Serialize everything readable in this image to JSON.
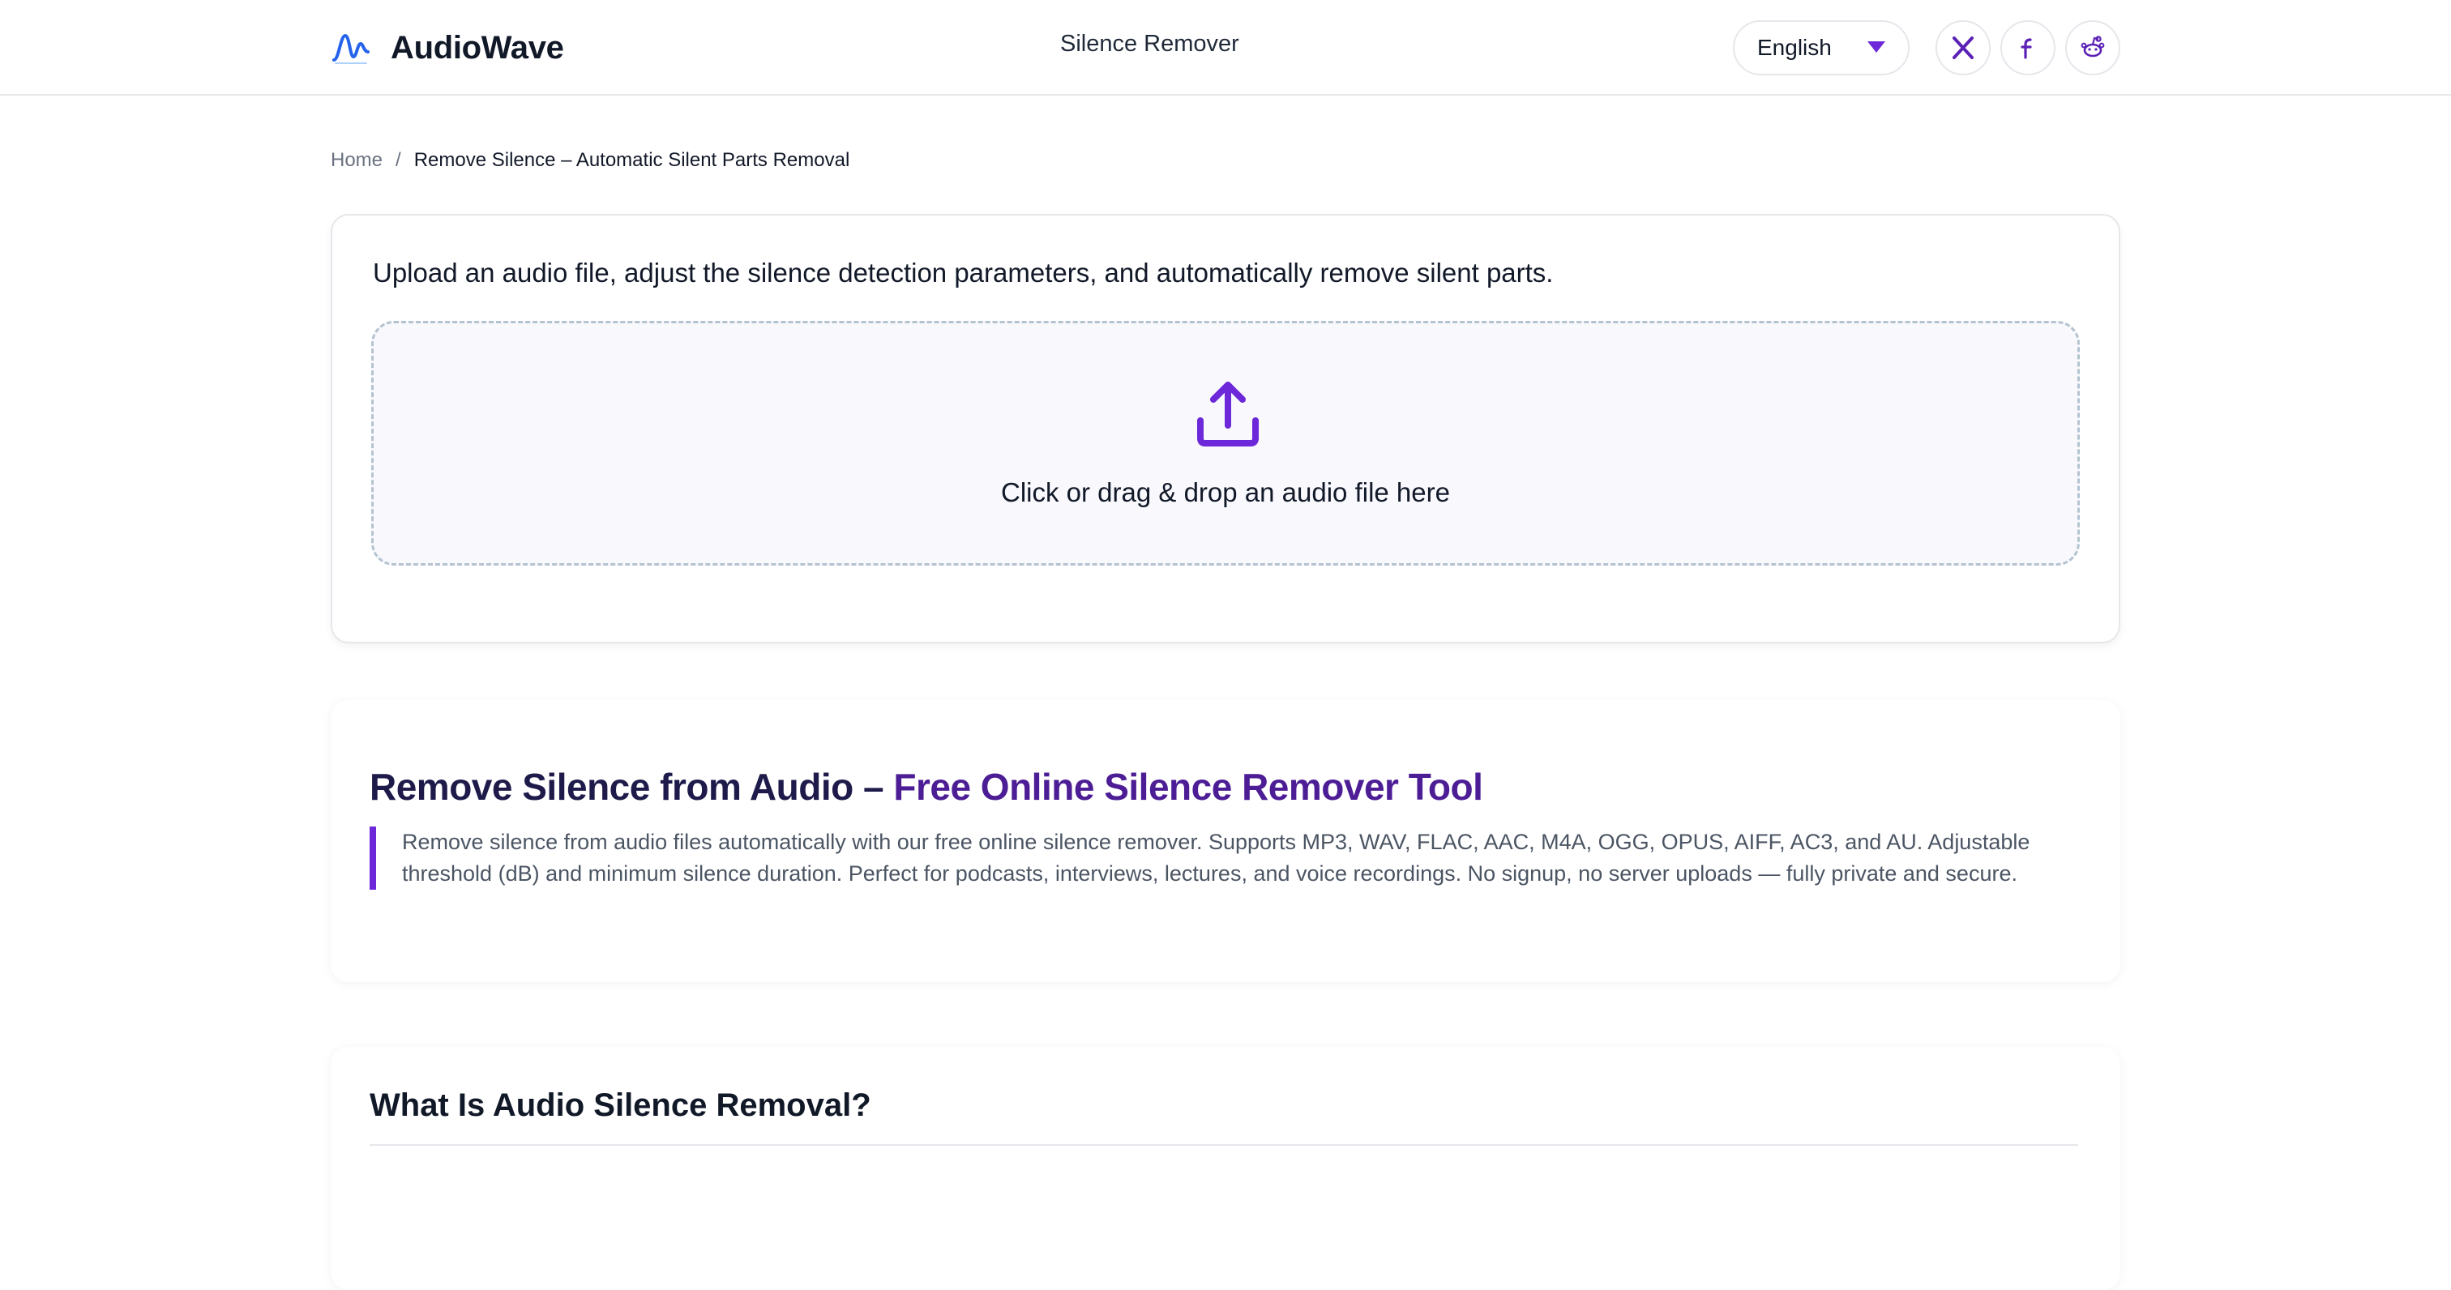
{
  "header": {
    "brand": "AudioWave",
    "nav_title": "Silence Remover",
    "language": "English",
    "social": [
      "x-icon",
      "facebook-icon",
      "reddit-icon"
    ]
  },
  "breadcrumb": {
    "home": "Home",
    "separator": "/",
    "current": "Remove Silence – Automatic Silent Parts Removal"
  },
  "upload": {
    "description": "Upload an audio file, adjust the silence detection parameters, and automatically remove silent parts.",
    "dropzone_text": "Click or drag & drop an audio file here",
    "icon": "upload-icon"
  },
  "intro": {
    "title_part1": "Remove Silence from Audio – ",
    "title_part2": "Free Online Silence Remover Tool",
    "body": "Remove silence from audio files automatically with our free online silence remover. Supports MP3, WAV, FLAC, AAC, M4A, OGG, OPUS, AIFF, AC3, and AU. Adjustable threshold (dB) and minimum silence duration. Perfect for podcasts, interviews, lectures, and voice recordings. No signup, no server uploads — fully private and secure."
  },
  "what": {
    "title": "What Is Audio Silence Removal?"
  },
  "colors": {
    "accent": "#6d28d9",
    "title_dark": "#1e1b4b",
    "title_purple": "#4c1d95",
    "dropzone_border": "#b4c3d0"
  }
}
